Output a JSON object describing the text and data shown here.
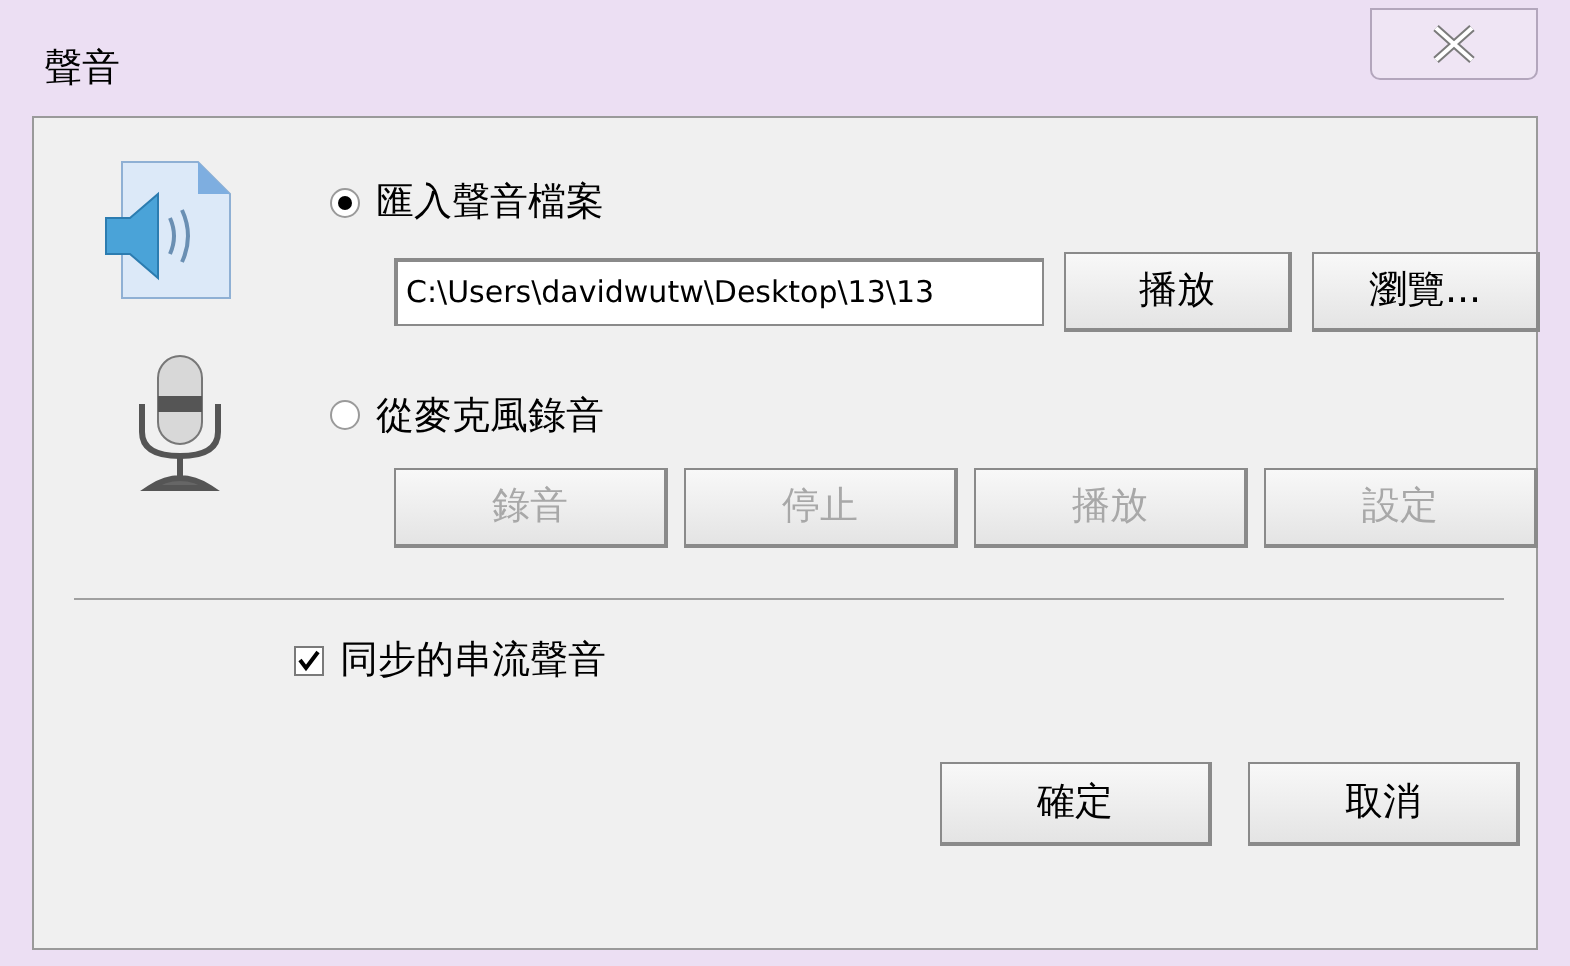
{
  "window": {
    "title": "聲音"
  },
  "file_option": {
    "label": "匯入聲音檔案",
    "selected": true,
    "path": "C:\\Users\\davidwutw\\Desktop\\13\\13",
    "buttons": [
      {
        "label": "播放",
        "disabled": false
      },
      {
        "label": "瀏覽...",
        "disabled": false
      }
    ]
  },
  "mic_option": {
    "label": "從麥克風錄音",
    "selected": false,
    "buttons": [
      {
        "label": "錄音",
        "disabled": true
      },
      {
        "label": "停止",
        "disabled": true
      },
      {
        "label": "播放",
        "disabled": true
      },
      {
        "label": "設定",
        "disabled": true
      }
    ]
  },
  "sync": {
    "label": "同步的串流聲音",
    "checked": true
  },
  "buttons": [
    {
      "label": "確定"
    },
    {
      "label": "取消"
    }
  ]
}
